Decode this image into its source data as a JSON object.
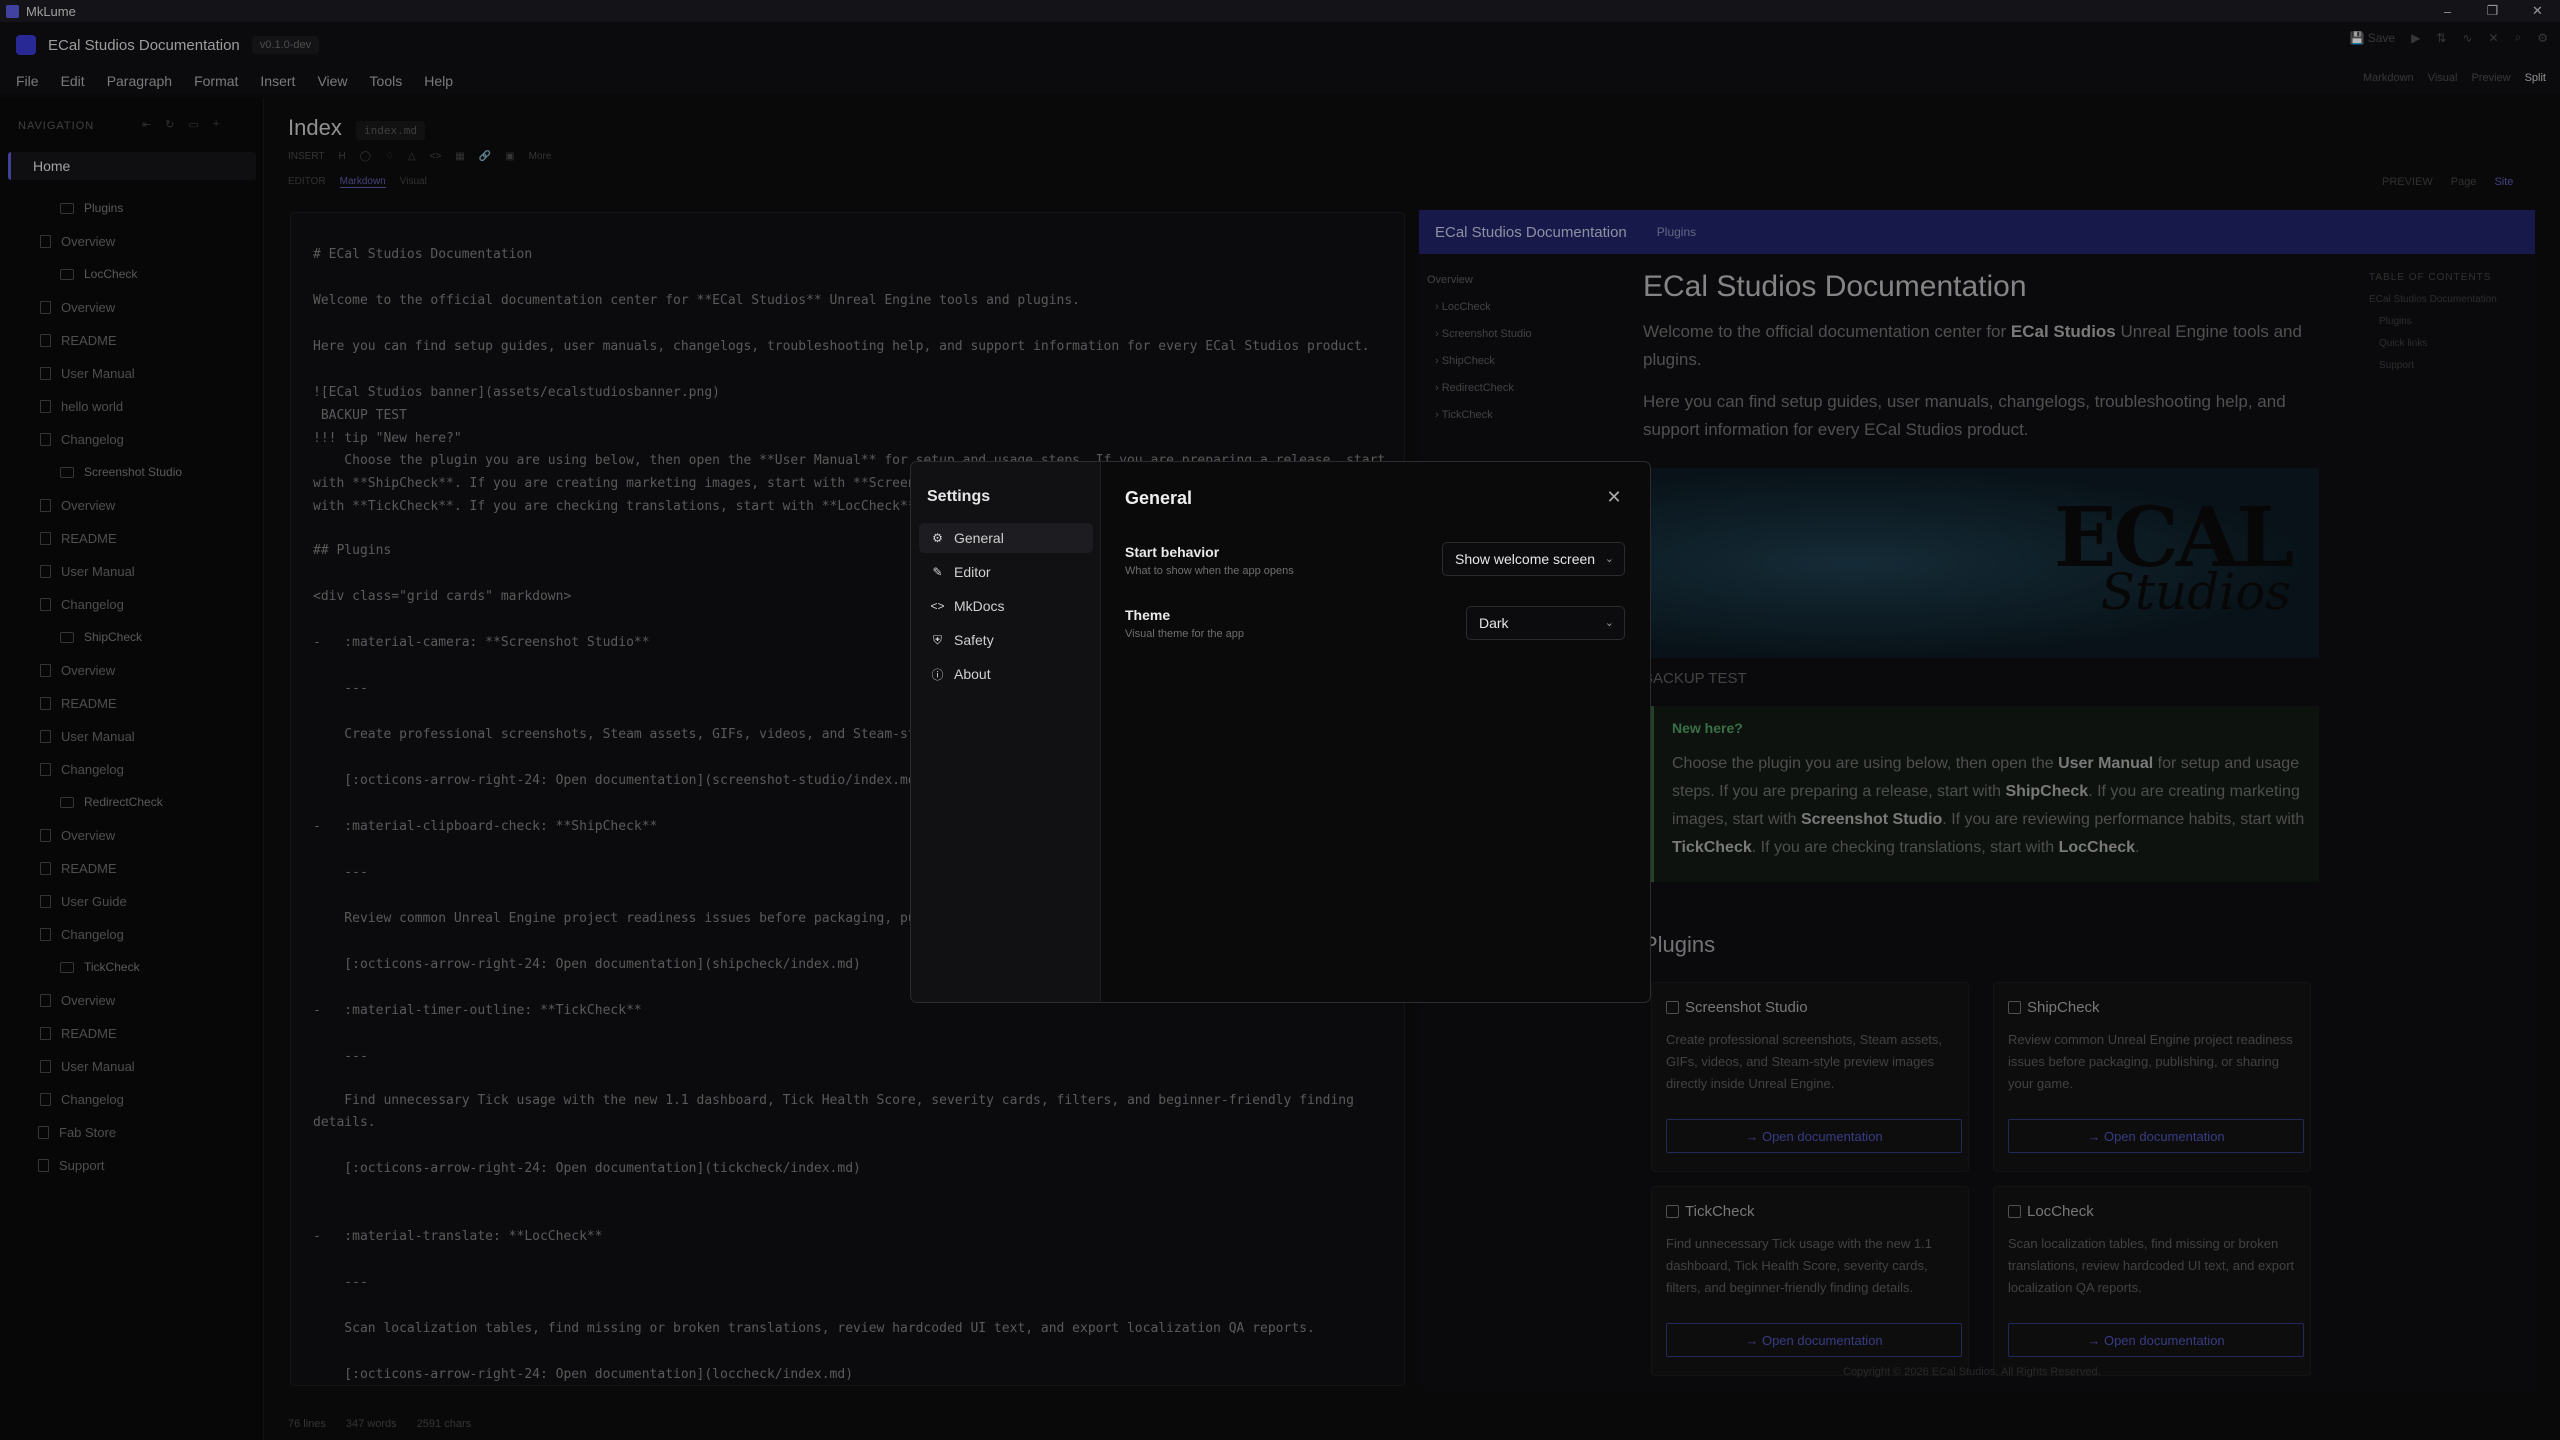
{
  "window": {
    "title": "MkLume",
    "controls": [
      "–",
      "❐",
      "✕"
    ]
  },
  "app": {
    "title": "ECal Studios Documentation",
    "version": "v0.1.0-dev",
    "save_label": "Save"
  },
  "menu": [
    "File",
    "Edit",
    "Paragraph",
    "Format",
    "Insert",
    "View",
    "Tools",
    "Help"
  ],
  "view_modes": {
    "markdown": "Markdown",
    "visual": "Visual",
    "preview": "Preview",
    "split": "Split"
  },
  "sidebar": {
    "heading": "NAVIGATION",
    "home": "Home",
    "items": [
      {
        "label": "Plugins",
        "type": "folder"
      },
      {
        "label": "Overview",
        "type": "page"
      },
      {
        "label": "LocCheck",
        "type": "folder"
      },
      {
        "label": "Overview",
        "type": "page"
      },
      {
        "label": "README",
        "type": "page"
      },
      {
        "label": "User Manual",
        "type": "page"
      },
      {
        "label": "hello world",
        "type": "page"
      },
      {
        "label": "Changelog",
        "type": "page"
      },
      {
        "label": "Screenshot Studio",
        "type": "folder"
      },
      {
        "label": "Overview",
        "type": "page"
      },
      {
        "label": "README",
        "type": "page"
      },
      {
        "label": "User Manual",
        "type": "page"
      },
      {
        "label": "Changelog",
        "type": "page"
      },
      {
        "label": "ShipCheck",
        "type": "folder"
      },
      {
        "label": "Overview",
        "type": "page"
      },
      {
        "label": "README",
        "type": "page"
      },
      {
        "label": "User Manual",
        "type": "page"
      },
      {
        "label": "Changelog",
        "type": "page"
      },
      {
        "label": "RedirectCheck",
        "type": "folder"
      },
      {
        "label": "Overview",
        "type": "page"
      },
      {
        "label": "README",
        "type": "page"
      },
      {
        "label": "User Guide",
        "type": "page"
      },
      {
        "label": "Changelog",
        "type": "page"
      },
      {
        "label": "TickCheck",
        "type": "folder"
      },
      {
        "label": "Overview",
        "type": "page"
      },
      {
        "label": "README",
        "type": "page"
      },
      {
        "label": "User Manual",
        "type": "page"
      },
      {
        "label": "Changelog",
        "type": "page"
      },
      {
        "label": "Fab Store",
        "type": "page"
      },
      {
        "label": "Support",
        "type": "page"
      }
    ]
  },
  "editor": {
    "page_title": "Index",
    "file_name": "index.md",
    "insert_label": "INSERT",
    "insert_more": "More",
    "mode_label": "EDITOR",
    "mode_markdown": "Markdown",
    "mode_visual": "Visual",
    "preview_label": "PREVIEW",
    "preview_page": "Page",
    "preview_site": "Site",
    "lines": [
      "# ECal Studios Documentation",
      "Welcome to the official documentation center for **ECal Studios** Unreal Engine tools and plugins.",
      "Here you can find setup guides, user manuals, changelogs, troubleshooting help, and support information for every ECal Studios product.",
      "![ECal Studios banner](assets/ecalstudiosbanner.png)",
      " BACKUP TEST",
      "!!! tip \"New here?\"",
      "    Choose the plugin you are using below, then open the **User Manual** for setup and usage steps. If you are preparing a release, start",
      "with **ShipCheck**. If you are creating marketing images, start with **Screensh",
      "with **TickCheck**. If you are checking translations, start with **LocCheck**.",
      "## Plugins",
      "<div class=\"grid cards\" markdown>",
      "-   :material-camera: **Screenshot Studio**",
      "    ---",
      "    Create professional screenshots, Steam assets, GIFs, videos, and Steam-sty",
      "    [:octicons-arrow-right-24: Open documentation](screenshot-studio/index.md)",
      "-   :material-clipboard-check: **ShipCheck**",
      "    ---",
      "    Review common Unreal Engine project readiness issues before packaging, pub",
      "    [:octicons-arrow-right-24: Open documentation](shipcheck/index.md)",
      "-   :material-timer-outline: **TickCheck**",
      "    ---",
      "    Find unnecessary Tick usage with the new 1.1 dashboard, Tick Health Score, severity cards, filters, and beginner-friendly finding",
      "details.",
      "    [:octicons-arrow-right-24: Open documentation](tickcheck/index.md)",
      "-   :material-translate: **LocCheck**",
      "    ---",
      "    Scan localization tables, find missing or broken translations, review hardcoded UI text, and export localization QA reports.",
      "    [:octicons-arrow-right-24: Open documentation](loccheck/index.md)"
    ],
    "status": {
      "lines": "76 lines",
      "words": "347 words",
      "chars": "2591 chars"
    }
  },
  "preview": {
    "site_title": "ECal Studios Documentation",
    "site_tab": "Plugins",
    "nav": [
      "Overview",
      "LocCheck",
      "Screenshot Studio",
      "ShipCheck",
      "RedirectCheck",
      "TickCheck"
    ],
    "h1": "ECal Studios Documentation",
    "p1_pre": "Welcome to the official documentation center for ",
    "p1_bold": "ECal Studios",
    "p1_post": " Unreal Engine tools and plugins.",
    "p2": "Here you can find setup guides, user manuals, changelogs, troubleshooting help, and support information for every ECal Studios product.",
    "banner_logo": "ECAL",
    "banner_sub": "Studios",
    "backup": "BACKUP TEST",
    "tip_title": "New here?",
    "tip_1": "Choose the plugin you are using below, then open the ",
    "tip_b1": "User Manual",
    "tip_2": " for setup and usage steps. If you are preparing a release, start with ",
    "tip_b2": "ShipCheck",
    "tip_3": ". If you are creating marketing images, start with ",
    "tip_b3": "Screenshot Studio",
    "tip_4": ". If you are reviewing performance habits, start with ",
    "tip_b4": "TickCheck",
    "tip_5": ". If you are checking translations, start with ",
    "tip_b5": "LocCheck",
    "tip_6": ".",
    "plugins_heading": "Plugins",
    "cards": [
      {
        "title": "Screenshot Studio",
        "desc": "Create professional screenshots, Steam assets, GIFs, videos, and Steam-style preview images directly inside Unreal Engine.",
        "button": "→ Open documentation"
      },
      {
        "title": "ShipCheck",
        "desc": "Review common Unreal Engine project readiness issues before packaging, publishing, or sharing your game.",
        "button": "→ Open documentation"
      },
      {
        "title": "TickCheck",
        "desc": "Find unnecessary Tick usage with the new 1.1 dashboard, Tick Health Score, severity cards, filters, and beginner-friendly finding details.",
        "button": "→ Open documentation"
      },
      {
        "title": "LocCheck",
        "desc": "Scan localization tables, find missing or broken translations, review hardcoded UI text, and export localization QA reports.",
        "button": "→ Open documentation"
      }
    ],
    "toc_heading": "TABLE OF CONTENTS",
    "toc": [
      "ECal Studios Documentation",
      "Plugins",
      "Quick links",
      "Support"
    ],
    "copyright": "Copyright © 2026 ECal Studios. All Rights Reserved."
  },
  "settings": {
    "title": "Settings",
    "nav": [
      {
        "label": "General",
        "icon": "gear-icon",
        "active": true
      },
      {
        "label": "Editor",
        "icon": "pencil-icon",
        "active": false
      },
      {
        "label": "MkDocs",
        "icon": "code-icon",
        "active": false
      },
      {
        "label": "Safety",
        "icon": "shield-icon",
        "active": false
      },
      {
        "label": "About",
        "icon": "info-icon",
        "active": false
      }
    ],
    "section_title": "General",
    "start_behavior": {
      "label": "Start behavior",
      "help": "What to show when the app opens",
      "value": "Show welcome screen"
    },
    "theme": {
      "label": "Theme",
      "help": "Visual theme for the app",
      "value": "Dark"
    }
  }
}
